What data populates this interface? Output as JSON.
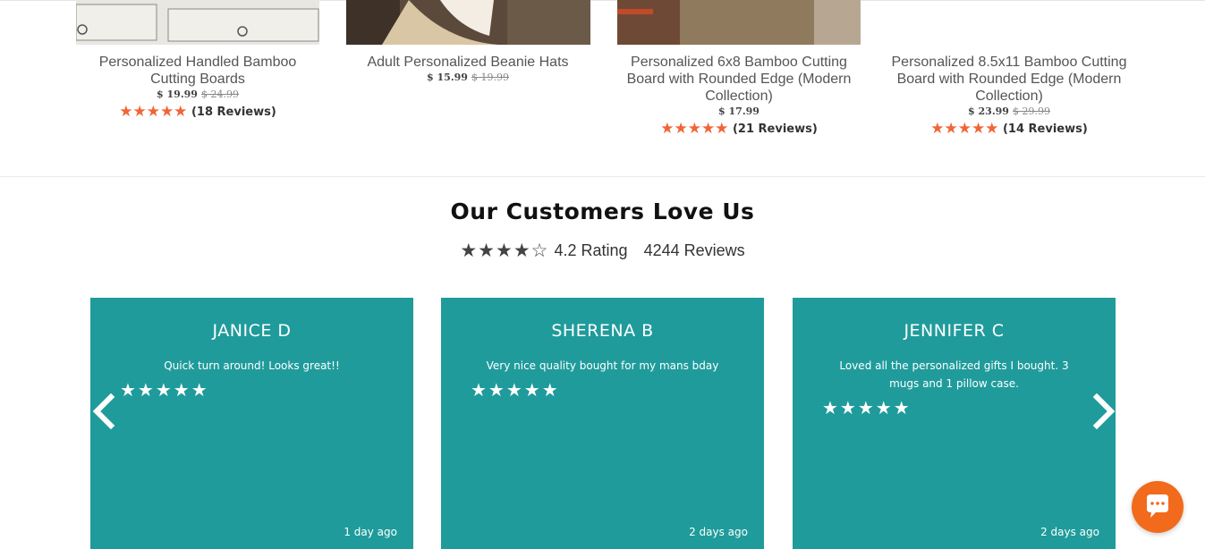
{
  "products": [
    {
      "title_line1": "Personalized Handled Bamboo",
      "title_line2": "Cutting Boards",
      "title_line3": "",
      "price": "$ 19.99",
      "was_price": "$ 24.99",
      "stars": "★★★★★",
      "review_count": "(18 Reviews)",
      "rating_fraction": 0.9
    },
    {
      "title_line1": "Adult Personalized Beanie Hats",
      "title_line2": "",
      "title_line3": "",
      "price": "$ 15.99",
      "was_price": "$ 19.99",
      "stars": "",
      "review_count": ""
    },
    {
      "title_line1": "Personalized 6x8 Bamboo Cutting",
      "title_line2": "Board with Rounded Edge (Modern",
      "title_line3": "Collection)",
      "price": "$ 17.99",
      "was_price": "",
      "stars": "★★★★★",
      "review_count": "(21 Reviews)",
      "rating_fraction": 0.9
    },
    {
      "title_line1": "Personalized 8.5x11 Bamboo Cutting",
      "title_line2": "Board with Rounded Edge (Modern",
      "title_line3": "Collection)",
      "price": "$ 23.99",
      "was_price": "$ 29.99",
      "stars": "★★★★★",
      "review_count": "(14 Reviews)",
      "rating_fraction": 0.9
    }
  ],
  "section": {
    "heading": "Our Customers Love Us",
    "stars": "★★★★☆",
    "rating_text": "4.2 Rating",
    "reviews_text": "4244 Reviews"
  },
  "reviews": [
    {
      "name": "JANICE D",
      "text": "Quick turn around! Looks great!!",
      "stars": "★★★★★",
      "time": "1 day ago"
    },
    {
      "name": "SHERENA B",
      "text": "Very nice quality bought for my mans bday",
      "stars": "★★★★★",
      "time": "2 days ago"
    },
    {
      "name": "JENNIFER C",
      "text": "Loved all the personalized gifts I bought. 3 mugs and 1 pillow case.",
      "stars": "★★★★★",
      "time": "2 days ago"
    }
  ],
  "colors": {
    "accent_star": "#f26436",
    "card_bg": "#209b9b",
    "chat_bg": "#f26a1b"
  },
  "icons": {
    "prev": "chevron-left-icon",
    "next": "chevron-right-icon",
    "chat": "chat-bubble-icon"
  }
}
